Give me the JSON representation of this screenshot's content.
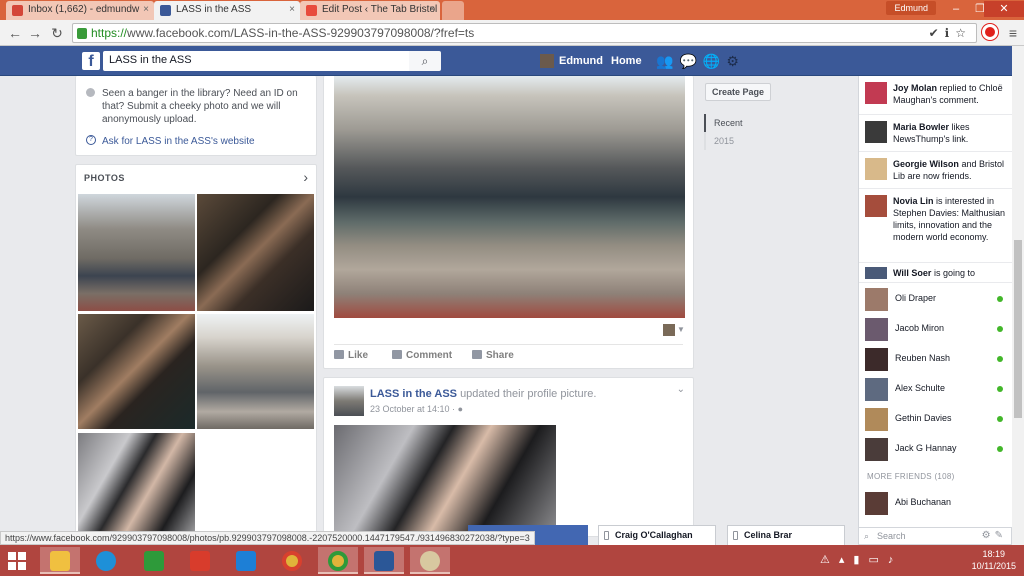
{
  "browser": {
    "tabs": [
      {
        "title": "Inbox (1,662) - edmundw",
        "icon_color": "#d44638"
      },
      {
        "title": "LASS in the ASS",
        "icon_color": "#3b5998"
      },
      {
        "title": "Edit Post ‹ The Tab Bristol",
        "icon_color": "#e84b3c"
      }
    ],
    "user": "Edmund",
    "url_https": "https://",
    "url_rest": "www.facebook.com/LASS-in-the-ASS-929903797098008/?fref=ts",
    "status_url": "https://www.facebook.com/929903797098008/photos/pb.929903797098008.-2207520000.1447179547./931496830272038/?type=3"
  },
  "fb_header": {
    "search_value": "LASS in the ASS",
    "user_name": "Edmund",
    "home_label": "Home"
  },
  "about": {
    "description": "Seen a banger in the library? Need an ID on that? Submit a cheeky photo and we will anonymously upload.",
    "ask_link": "Ask for LASS in the ASS's website"
  },
  "photos": {
    "heading": "PHOTOS"
  },
  "post1": {
    "like": "Like",
    "comment": "Comment",
    "share": "Share"
  },
  "post2": {
    "page_name": "LASS in the ASS",
    "action": "updated their profile picture.",
    "date": "23 October at 14:10 · "
  },
  "timeline": {
    "create_page": "Create Page",
    "years": [
      "Recent",
      "2015"
    ]
  },
  "ticker": [
    {
      "name": "Joy Molan",
      "text": "replied to Chloë Maughan's comment."
    },
    {
      "name": "Maria Bowler",
      "text": "likes NewsThump's link."
    },
    {
      "name": "Georgie Wilson",
      "text": "and Bristol Lib are now friends."
    },
    {
      "name": "Novia Lin",
      "text": "is interested in Stephen Davies: Malthusian limits, innovation and the modern world economy."
    },
    {
      "name": "Will Soer",
      "text": "is going to"
    }
  ],
  "contacts": [
    "Oli Draper",
    "Jacob Miron",
    "Reuben Nash",
    "Alex Schulte",
    "Gethin Davies",
    "Jack G Hannay"
  ],
  "more_friends_label": "MORE FRIENDS (108)",
  "more_contacts": [
    "Abi Buchanan"
  ],
  "sidebar_search_placeholder": "Search",
  "chat_tabs": [
    "Craig O'Callaghan",
    "Celina Brar"
  ],
  "clock": {
    "time": "18:19",
    "date": "10/11/2015"
  },
  "colors": {
    "fb_blue": "#3b5998",
    "chrome_frame": "#d9643c",
    "taskbar": "#b0453f",
    "online_green": "#42b72a"
  }
}
